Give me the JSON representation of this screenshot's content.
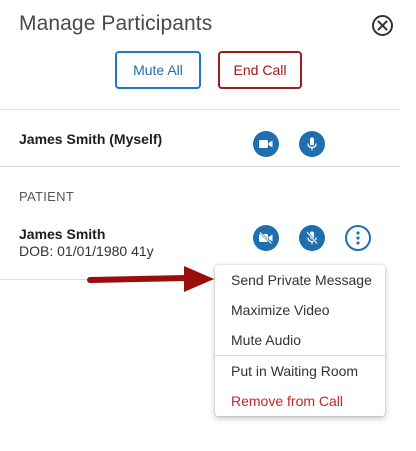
{
  "header": {
    "title": "Manage Participants",
    "close_icon": "close-circle-icon"
  },
  "actions": {
    "mute_all_label": "Mute All",
    "end_call_label": "End Call"
  },
  "self": {
    "name": "James Smith (Myself)",
    "video_icon": "video-camera-icon",
    "audio_icon": "microphone-icon"
  },
  "patient_section": {
    "label": "PATIENT",
    "name": "James Smith",
    "dob": "DOB: 01/01/1980 41y",
    "video_icon": "video-camera-off-icon",
    "audio_icon": "microphone-off-icon",
    "more_icon": "more-vertical-icon"
  },
  "context_menu": {
    "items": [
      {
        "label": "Send Private Message"
      },
      {
        "label": "Maximize Video"
      },
      {
        "label": "Mute Audio"
      },
      {
        "label": "Put in Waiting Room"
      },
      {
        "label": "Remove from Call"
      }
    ]
  },
  "colors": {
    "primary": "#1f6fb0",
    "danger": "#a01818",
    "annotation_arrow": "#9b0d0d"
  }
}
